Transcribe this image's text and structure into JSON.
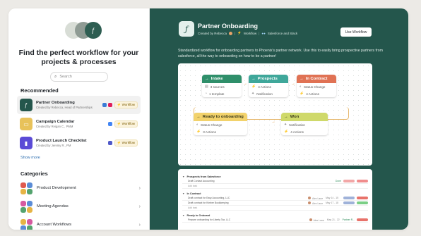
{
  "left": {
    "hero_logo_glyph": "ƒ",
    "title": "Find the perfect workflow for your projects & processes",
    "search": {
      "placeholder": "Search",
      "icon": "search-icon"
    },
    "recommended_heading": "Recommended",
    "recommended": [
      {
        "name": "Partner Onboarding",
        "sub": "Created by Rebecca, Head of Partnerships",
        "icon_color": "#24564c",
        "icon_glyph": "ƒ",
        "tag": "Workflow",
        "apps": [
          "#3a7bd5",
          "#e01e5a"
        ],
        "active": true
      },
      {
        "name": "Campaign Calendar",
        "sub": "Created by Reigan C., PMM",
        "icon_color": "#e8c25a",
        "icon_glyph": "▭",
        "tag": "Workflow",
        "apps": [
          "#4285f4"
        ],
        "active": false
      },
      {
        "name": "Product Launch Checklist",
        "sub": "Created by Jeremy R., PM",
        "icon_color": "#5b4bd6",
        "icon_glyph": "▮",
        "tag": "Workflow",
        "apps": [
          "#5059c9"
        ],
        "active": false
      }
    ],
    "show_more": "Show more",
    "categories_heading": "Categories",
    "categories": [
      {
        "name": "Product Development",
        "colors": [
          "#e05a4f",
          "#5b8cd6",
          "#e6b445",
          "#54a36e"
        ]
      },
      {
        "name": "Meeting Agendas",
        "colors": [
          "#d65aa0",
          "#5b8cd6",
          "#54a36e",
          "#e6b445"
        ]
      },
      {
        "name": "Account Workflows",
        "colors": [
          "#e6b445",
          "#d65aa0",
          "#5b8cd6",
          "#54a36e"
        ]
      }
    ]
  },
  "workflow": {
    "title": "Partner Onboarding",
    "created_by": "Created by Rebecca",
    "type_label": "Workflow",
    "integrations": "Salesforce and Slack",
    "use_button": "Use Workflow",
    "description": "Standardized workflow for onboarding partners to Phoenix's partner network. Use this to easily bring prospective partners from salesforce, all the way to onboarding on how to be a partner!",
    "nodes": [
      {
        "title": "Intake",
        "color": "#2f8f6a",
        "rows": [
          "3 sources",
          "1 template"
        ]
      },
      {
        "title": "Prospects",
        "color": "#3fa79a",
        "rows": [
          "4 Actions",
          "Notification"
        ]
      },
      {
        "title": "In Contract",
        "color": "#e07254",
        "rows": [
          "Status Change",
          "4 Actions"
        ]
      },
      {
        "title": "Ready to onboarding",
        "color": "#f2d26b",
        "rows": [
          "Status Change",
          "3 Actions"
        ]
      },
      {
        "title": "Won",
        "color": "#cfd96a",
        "rows": [
          "Notification",
          "4 Actions"
        ]
      }
    ],
    "table_groups": [
      {
        "title": "Prospects from Salesforce",
        "rows": [
          {
            "name": "Draft Contact Accounting",
            "date": "",
            "owner": "",
            "status": "Done",
            "pills": [
              "#f2a7a7",
              "#f08c8c"
            ]
          }
        ],
        "add": "Add task"
      },
      {
        "title": "In Contract",
        "rows": [
          {
            "name": "Draft contract for Easy Accounting, LLC",
            "date": "May 14 - 15",
            "owner": "Alex Lane",
            "status": "",
            "pills": [
              "#9fb2d9",
              "#e8726a"
            ]
          },
          {
            "name": "Draft contract for Kimber Bookkeeping",
            "date": "May 17 - 18",
            "owner": "Alex Lane",
            "status": "",
            "pills": [
              "#9fb2d9",
              "#7bcf86"
            ]
          }
        ],
        "add": "Add task"
      },
      {
        "title": "Ready to Onboard",
        "rows": [
          {
            "name": "Prepare onboarding for Liberty Tax, LLC",
            "date": "May 21 - 22",
            "owner": "Alex Lane",
            "status": "Partner R...",
            "pills": [
              "#e8726a"
            ]
          }
        ],
        "add": ""
      }
    ]
  }
}
